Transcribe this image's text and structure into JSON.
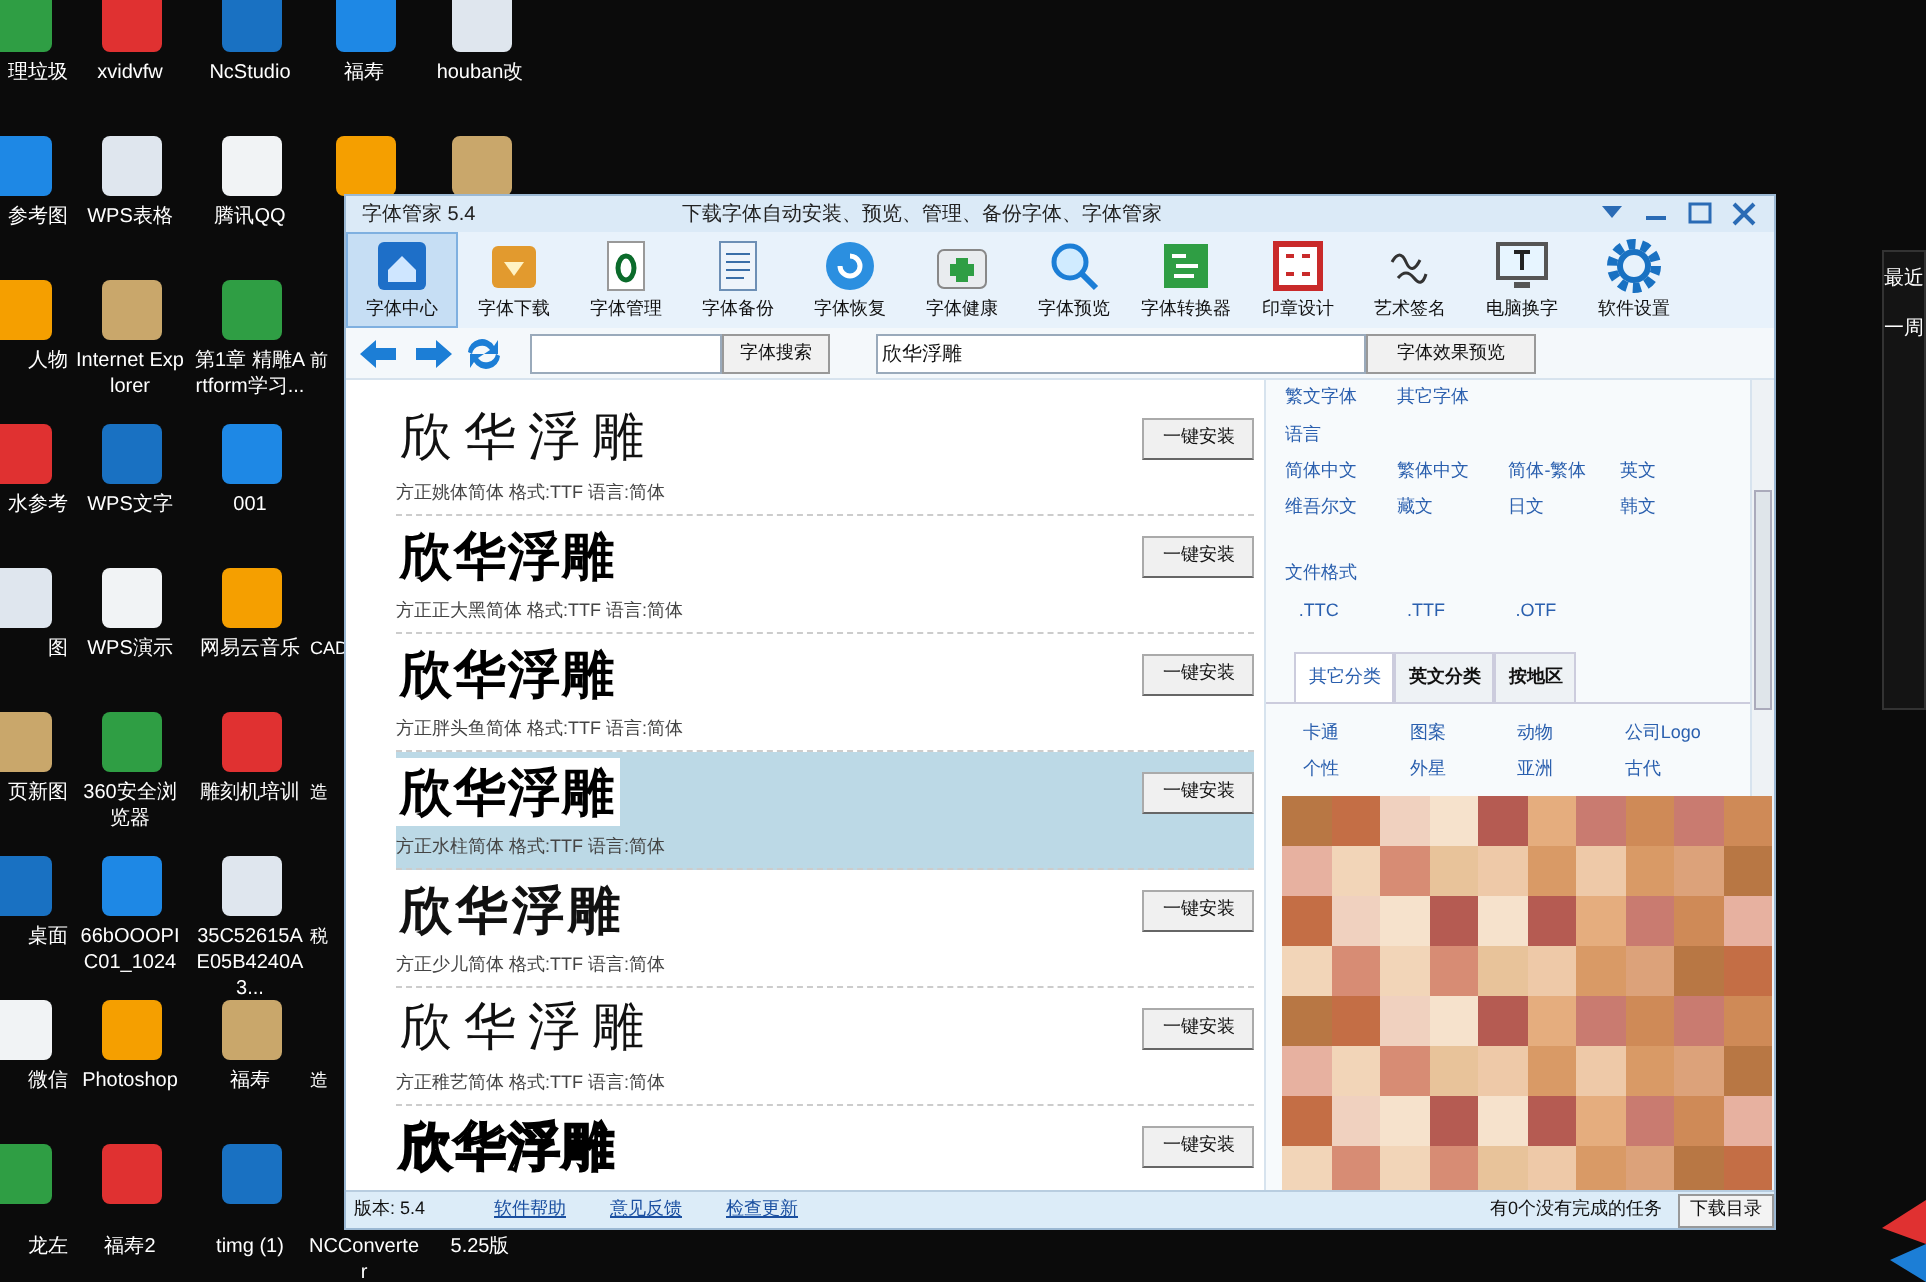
{
  "desktop": {
    "columns": [
      [
        {
          "label": "理垃圾"
        },
        {
          "label": "参考图"
        },
        {
          "label": "人物"
        },
        {
          "label": "水参考"
        },
        {
          "label": "图"
        },
        {
          "label": "页新图"
        },
        {
          "label": "桌面"
        },
        {
          "label": "微信"
        },
        {
          "label": "龙左"
        }
      ],
      [
        {
          "label": "xvidvfw"
        },
        {
          "label": "WPS表格"
        },
        {
          "label": "Internet Explorer"
        },
        {
          "label": "WPS文字"
        },
        {
          "label": "WPS演示"
        },
        {
          "label": "360安全浏览器"
        },
        {
          "label": "66bOOOPIC01_1024"
        },
        {
          "label": "Photoshop"
        },
        {
          "label": "福寿2"
        }
      ],
      [
        {
          "label": "NcStudio"
        },
        {
          "label": "腾讯QQ"
        },
        {
          "label": "第1章 精雕Artform学习..."
        },
        {
          "label": "001"
        },
        {
          "label": "网易云音乐"
        },
        {
          "label": "雕刻机培训"
        },
        {
          "label": "35C52615AE05B4240A3..."
        },
        {
          "label": "福寿"
        },
        {
          "label": "timg (1)"
        }
      ],
      [
        {
          "label": "福寿"
        },
        {},
        {
          "label": "前"
        },
        null,
        {
          "label": "CAD"
        },
        {
          "label": "造"
        },
        {
          "label": "税"
        },
        {
          "label": "造"
        },
        {
          "label": "NCConverter"
        }
      ],
      [
        {
          "label": "houban改"
        },
        {},
        null,
        null,
        null,
        null,
        null,
        null,
        {
          "label": "5.25版"
        }
      ]
    ],
    "recent_panel": {
      "labels": [
        "最近",
        "一周"
      ]
    }
  },
  "window": {
    "title": "字体管家 5.4",
    "subtitle": "下载字体自动安装、预览、管理、备份字体、字体管家",
    "toolbar": [
      {
        "label": "字体中心",
        "selected": true
      },
      {
        "label": "字体下载",
        "selected": false
      },
      {
        "label": "字体管理",
        "selected": false
      },
      {
        "label": "字体备份",
        "selected": false
      },
      {
        "label": "字体恢复",
        "selected": false
      },
      {
        "label": "字体健康",
        "selected": false
      },
      {
        "label": "字体预览",
        "selected": false
      },
      {
        "label": "字体转换器",
        "selected": false
      },
      {
        "label": "印章设计",
        "selected": false
      },
      {
        "label": "艺术签名",
        "selected": false
      },
      {
        "label": "电脑换字",
        "selected": false
      },
      {
        "label": "软件设置",
        "selected": false
      }
    ],
    "search": {
      "button": "字体搜索"
    },
    "preview": {
      "value": "欣华浮雕",
      "button": "字体效果预览"
    },
    "fonts": [
      {
        "preview": "欣华浮雕",
        "kind": "light",
        "meta": "方正姚体简体  格式:TTF 语言:简体",
        "button": "一键安装",
        "selected": false
      },
      {
        "preview": "欣华浮雕",
        "kind": "heavy",
        "meta": "方正正大黑简体  格式:TTF 语言:简体",
        "button": "一键安装",
        "selected": false
      },
      {
        "preview": "欣华浮雕",
        "kind": "heavy",
        "meta": "方正胖头鱼简体  格式:TTF 语言:简体",
        "button": "一键安装",
        "selected": false
      },
      {
        "preview": "欣华浮雕",
        "kind": "heavy",
        "meta": "方正水柱简体  格式:TTF 语言:简体",
        "button": "一键安装",
        "selected": true
      },
      {
        "preview": "欣华浮雕",
        "kind": "bold",
        "meta": "方正少儿简体  格式:TTF 语言:简体",
        "button": "一键安装",
        "selected": false
      },
      {
        "preview": "欣华浮雕",
        "kind": "light",
        "meta": "方正稚艺简体  格式:TTF 语言:简体",
        "button": "一键安装",
        "selected": false
      },
      {
        "preview": "欣华浮雕",
        "kind": "outline",
        "button": "一键安装",
        "selected": false
      }
    ],
    "filters": {
      "top_links": [
        "繁文字体",
        "其它字体"
      ],
      "language": {
        "heading": "语言",
        "items": [
          "简体中文",
          "繁体中文",
          "简体-繁体",
          "英文",
          "维吾尔文",
          "藏文",
          "日文",
          "韩文"
        ]
      },
      "format": {
        "heading": "文件格式",
        "items": [
          ".TTC",
          ".TTF",
          ".OTF"
        ]
      },
      "tabs": [
        {
          "label": "其它分类",
          "selected": true
        },
        {
          "label": "英文分类",
          "selected": false
        },
        {
          "label": "按地区",
          "selected": false
        }
      ],
      "categories": [
        "卡通",
        "图案",
        "动物",
        "公司Logo",
        "个性",
        "外星",
        "亚洲",
        "古代"
      ]
    },
    "status_bar": {
      "version": "版本: 5.4",
      "links": [
        "软件帮助",
        "意见反馈",
        "检查更新"
      ],
      "tasks": "有0个没有完成的任务",
      "button": "下载目录"
    }
  }
}
